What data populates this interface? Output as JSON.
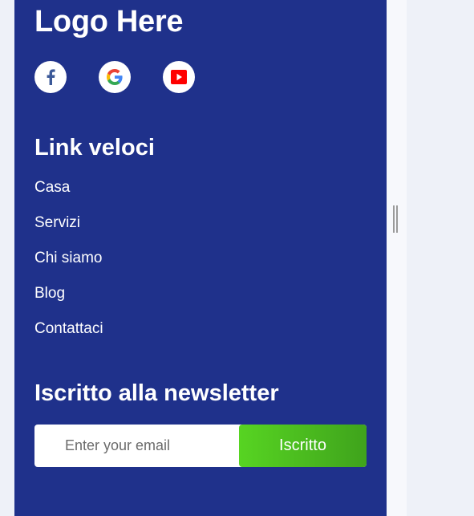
{
  "footer": {
    "logo_text": "Logo Here",
    "social": [
      {
        "name": "facebook-icon",
        "color": "#3b5998"
      },
      {
        "name": "google-icon",
        "colors": [
          "#4285F4",
          "#EA4335",
          "#FBBC05",
          "#34A853"
        ]
      },
      {
        "name": "youtube-icon",
        "color": "#ff0000"
      }
    ],
    "quick_links": {
      "heading": "Link veloci",
      "items": [
        "Casa",
        "Servizi",
        "Chi siamo",
        "Blog",
        "Contattaci"
      ]
    },
    "newsletter": {
      "heading": "Iscritto alla newsletter",
      "email_placeholder": "Enter your email",
      "submit_label": "Iscritto"
    }
  },
  "colors": {
    "panel_background": "#1f318b",
    "page_background": "#eef1f8",
    "button_gradient_start": "#57d422",
    "button_gradient_end": "#3fa31c",
    "text": "#ffffff"
  }
}
